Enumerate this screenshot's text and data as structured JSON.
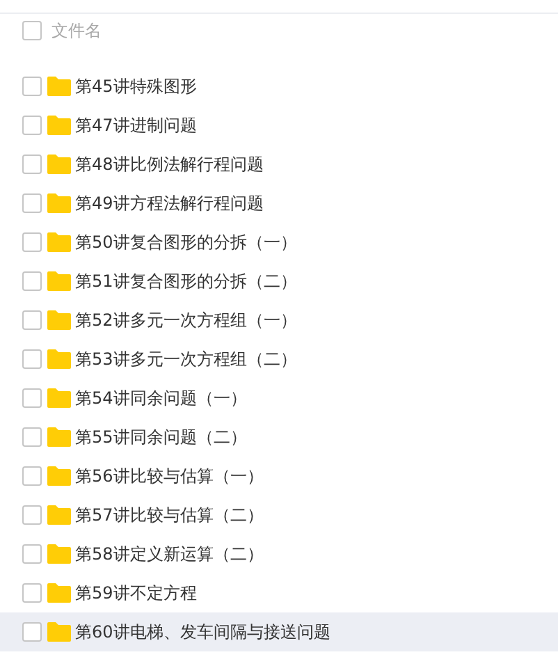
{
  "header": {
    "checked": false,
    "label": "文件名"
  },
  "rows": [
    {
      "name": "第45讲特殊图形",
      "checked": false,
      "hovered": false
    },
    {
      "name": "第47讲进制问题",
      "checked": false,
      "hovered": false
    },
    {
      "name": "第48讲比例法解行程问题",
      "checked": false,
      "hovered": false
    },
    {
      "name": "第49讲方程法解行程问题",
      "checked": false,
      "hovered": false
    },
    {
      "name": "第50讲复合图形的分拆（一）",
      "checked": false,
      "hovered": false
    },
    {
      "name": "第51讲复合图形的分拆（二）",
      "checked": false,
      "hovered": false
    },
    {
      "name": "第52讲多元一次方程组（一）",
      "checked": false,
      "hovered": false
    },
    {
      "name": "第53讲多元一次方程组（二）",
      "checked": false,
      "hovered": false
    },
    {
      "name": "第54讲同余问题（一）",
      "checked": false,
      "hovered": false
    },
    {
      "name": "第55讲同余问题（二）",
      "checked": false,
      "hovered": false
    },
    {
      "name": "第56讲比较与估算（一）",
      "checked": false,
      "hovered": false
    },
    {
      "name": "第57讲比较与估算（二）",
      "checked": false,
      "hovered": false
    },
    {
      "name": "第58讲定义新运算（二）",
      "checked": false,
      "hovered": false
    },
    {
      "name": "第59讲不定方程",
      "checked": false,
      "hovered": false
    },
    {
      "name": "第60讲电梯、发车间隔与接送问题",
      "checked": false,
      "hovered": true
    }
  ]
}
